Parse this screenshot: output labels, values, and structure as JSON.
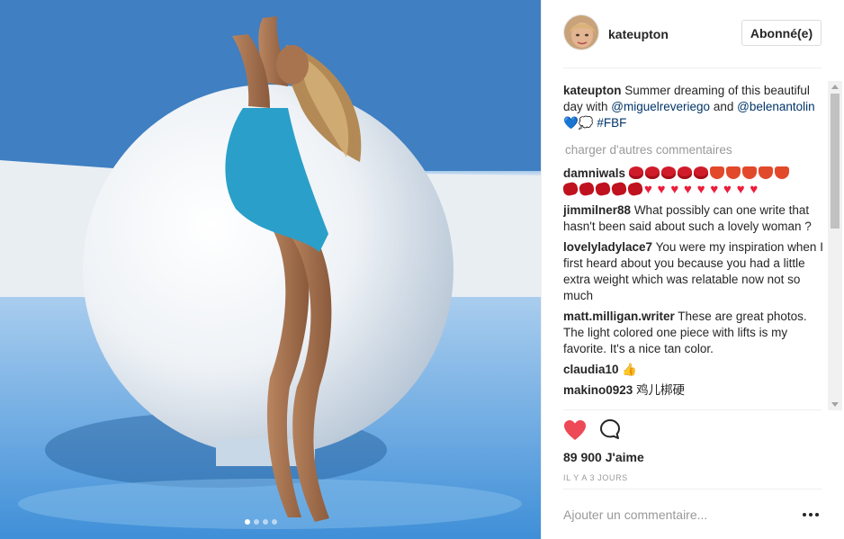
{
  "photo": {
    "slides": 4,
    "active_slide": 1
  },
  "header": {
    "username": "kateupton",
    "follow_label": "Abonné(e)"
  },
  "caption": {
    "author": "kateupton",
    "text_1": "Summer dreaming of this beautiful day with",
    "mention_1": "@miguelreveriego",
    "text_2": "and",
    "mention_2": "@belenantolin",
    "emoji": "💙💭",
    "hashtag": "#FBF"
  },
  "load_more": "charger d'autres commentaires",
  "comments": [
    {
      "author": "damniwals",
      "text": ""
    },
    {
      "author": "jimmilner88",
      "text": "What possibly can one write that hasn't been said about such a lovely woman ?"
    },
    {
      "author": "lovelyladylace7",
      "text": "You were my inspiration when I first heard about you because you had a little extra weight which was relatable now not so much"
    },
    {
      "author": "matt.milligan.writer",
      "text": "These are great photos. The light colored one piece with lifts is my favorite. It's a nice tan color."
    },
    {
      "author": "claudia10",
      "text": "👍"
    },
    {
      "author": "makino0923",
      "text": "鸡儿梆硬"
    }
  ],
  "likes": "89 900 J'aime",
  "timestamp": "IL Y A 3 JOURS",
  "add_comment": {
    "placeholder": "Ajouter un commentaire..."
  },
  "colors": {
    "like": "#ed4956",
    "link": "#003569",
    "muted": "#999999"
  }
}
